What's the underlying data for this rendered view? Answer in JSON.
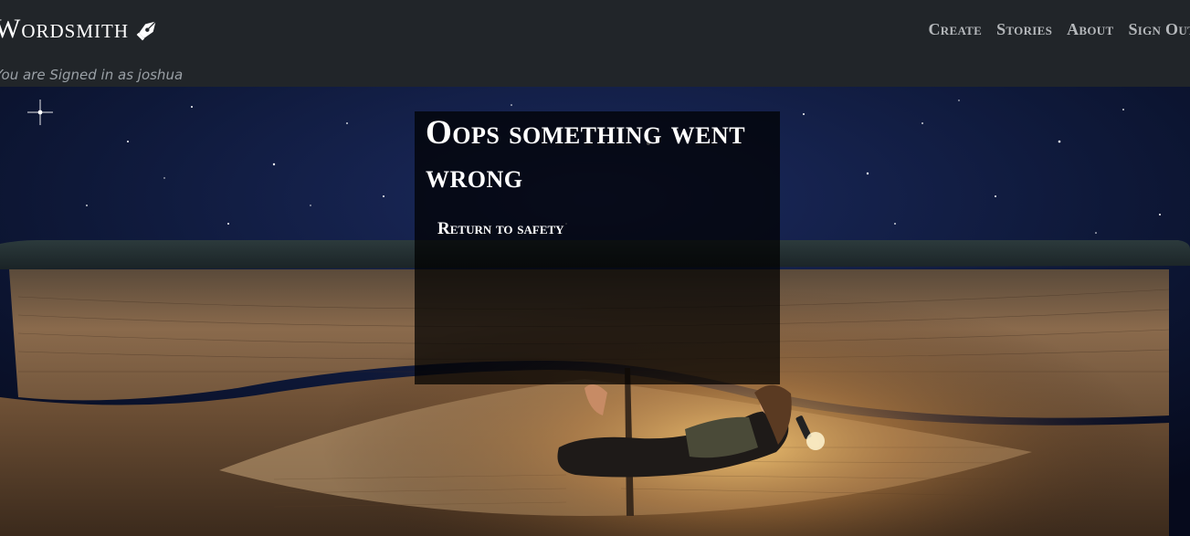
{
  "header": {
    "brand": "Wordsmith",
    "brand_icon": "fountain-pen-icon",
    "signed_in_text": "You are Signed in as joshua",
    "nav": [
      {
        "label": "Create"
      },
      {
        "label": "Stories"
      },
      {
        "label": "About"
      },
      {
        "label": "Sign Out"
      }
    ]
  },
  "error": {
    "title": "Oops something went wrong",
    "return_label": "Return to safety"
  },
  "colors": {
    "navbar": "#212529",
    "nav_link": "#b5b8bb",
    "signed_in_text": "#9aa0a6",
    "card_overlay": "rgba(0,0,0,0.72)"
  }
}
